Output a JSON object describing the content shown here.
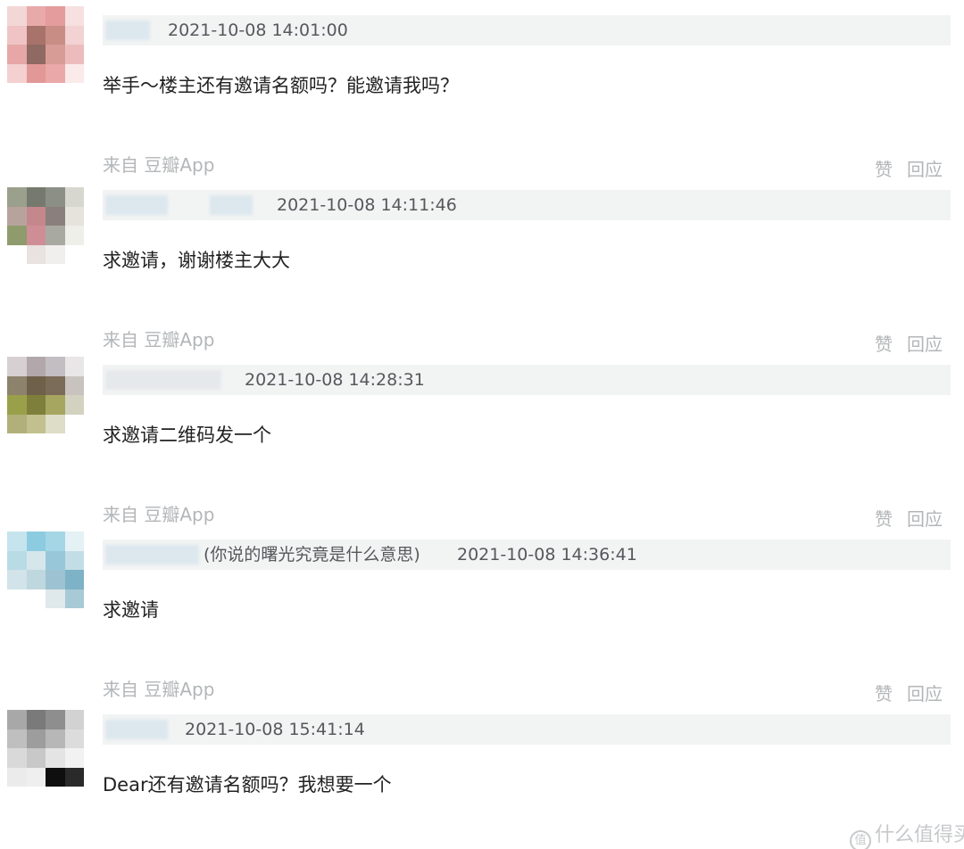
{
  "comments": [
    {
      "timestamp": "2021-10-08 14:01:00",
      "text": "举手～楼主还有邀请名额吗？能邀请我吗？",
      "source": "来自 豆瓣App",
      "like": "赞",
      "reply": "回应"
    },
    {
      "timestamp": "2021-10-08 14:11:46",
      "text": "求邀请，谢谢楼主大大",
      "source": "来自 豆瓣App",
      "like": "赞",
      "reply": "回应"
    },
    {
      "timestamp": "2021-10-08 14:28:31",
      "text": "求邀请二维码发一个",
      "source": "来自 豆瓣App",
      "like": "赞",
      "reply": "回应"
    },
    {
      "signature": "(你说的曙光究竟是什么意思)",
      "timestamp": "2021-10-08 14:36:41",
      "text": "求邀请",
      "source": "来自 豆瓣App",
      "like": "赞",
      "reply": "回应"
    },
    {
      "timestamp": "2021-10-08 15:41:14",
      "text": "Dear还有邀请名额吗？我想要一个"
    }
  ],
  "watermark": {
    "logo": "值",
    "text": "什么值得买"
  }
}
